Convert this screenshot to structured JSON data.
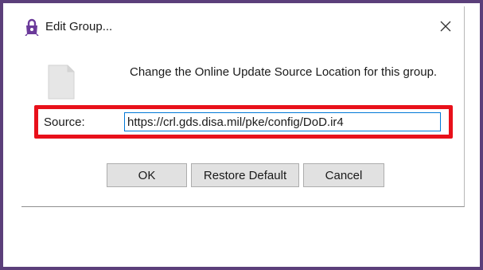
{
  "window": {
    "title": "Edit Group...",
    "app_icon": "padlock-icon",
    "close_icon": "close-icon",
    "accent_color": "#5b3f7a"
  },
  "body": {
    "doc_icon": "document-icon",
    "message": "Change the Online Update Source Location for this group.",
    "source_label": "Source:",
    "source_value": "https://crl.gds.disa.mil/pke/config/DoD.ir4",
    "highlight_color": "#e8101a"
  },
  "buttons": {
    "ok_label": "OK",
    "restore_label": "Restore Default",
    "cancel_label": "Cancel"
  }
}
